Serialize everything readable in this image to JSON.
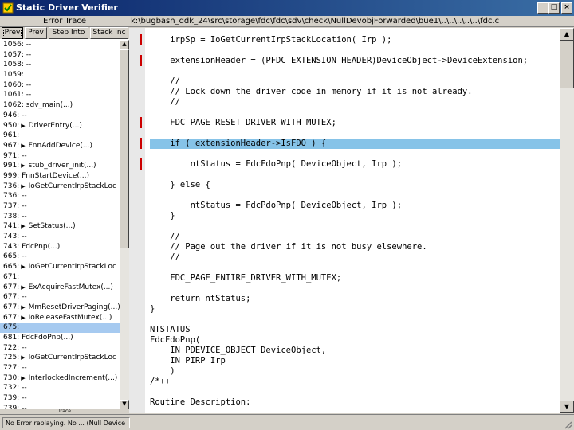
{
  "window": {
    "title": "Static Driver Verifier",
    "minimize": "_",
    "maximize": "□",
    "close": "×"
  },
  "trace_panel": {
    "header": "Error Trace",
    "buttons": [
      "Prev",
      "Prev",
      "Step Into",
      "Stack Inc"
    ],
    "footer": "Trace",
    "rows": [
      {
        "text": "1056: --",
        "arrow": false
      },
      {
        "text": "1057: --",
        "arrow": false
      },
      {
        "text": "1058: --",
        "arrow": false
      },
      {
        "text": "1059:",
        "arrow": false
      },
      {
        "text": "1060: --",
        "arrow": false
      },
      {
        "text": "1061: --",
        "arrow": false
      },
      {
        "text": "1062: sdv_main(...)",
        "arrow": false
      },
      {
        "text": "946: --",
        "arrow": false
      },
      {
        "text": "950:",
        "arrow": true,
        "call": "DriverEntry(...)"
      },
      {
        "text": "961:",
        "arrow": false
      },
      {
        "text": "967:",
        "arrow": true,
        "call": "FnnAddDevice(...)"
      },
      {
        "text": "971: --",
        "arrow": false
      },
      {
        "text": "991:",
        "arrow": true,
        "call": "stub_driver_init(...)"
      },
      {
        "text": "999: FnnStartDevice(...)",
        "arrow": false
      },
      {
        "text": "736:",
        "arrow": true,
        "call": "IoGetCurrentIrpStackLoc"
      },
      {
        "text": "736: --",
        "arrow": false
      },
      {
        "text": "737: --",
        "arrow": false
      },
      {
        "text": "738: --",
        "arrow": false
      },
      {
        "text": "741:",
        "arrow": true,
        "call": "SetStatus(...)"
      },
      {
        "text": "743: --",
        "arrow": false
      },
      {
        "text": "743: FdcPnp(...)",
        "arrow": false
      },
      {
        "text": "665: --",
        "arrow": false
      },
      {
        "text": "665:",
        "arrow": true,
        "call": "IoGetCurrentIrpStackLoc"
      },
      {
        "text": "671:",
        "arrow": false
      },
      {
        "text": "677:",
        "arrow": true,
        "call": "ExAcquireFastMutex(...)"
      },
      {
        "text": "677: --",
        "arrow": false
      },
      {
        "text": "677:",
        "arrow": true,
        "call": "MmResetDriverPaging(...)"
      },
      {
        "text": "677:",
        "arrow": true,
        "call": "IoReleaseFastMutex(...)"
      },
      {
        "text": "675:",
        "arrow": false,
        "selected": true
      },
      {
        "text": "681: FdcFdoPnp(...)",
        "arrow": false
      },
      {
        "text": "722: --",
        "arrow": false
      },
      {
        "text": "725:",
        "arrow": true,
        "call": "IoGetCurrentIrpStackLoc"
      },
      {
        "text": "727: --",
        "arrow": false
      },
      {
        "text": "730:",
        "arrow": true,
        "call": "InterlockedIncrement(...)"
      },
      {
        "text": "732: --",
        "arrow": false
      },
      {
        "text": "739: --",
        "arrow": false
      },
      {
        "text": "739: --",
        "arrow": false
      }
    ]
  },
  "code_panel": {
    "path": "k:\\bugbash_ddk_24\\src\\storage\\fdc\\fdc\\sdv\\check\\NullDevobjForwarded\\bue1\\..\\..\\..\\..\\..\\fdc.c",
    "lines": [
      {
        "text": "    irpSp = IoGetCurrentIrpStackLocation( Irp );",
        "marker": true
      },
      {
        "text": "",
        "marker": false
      },
      {
        "text": "    extensionHeader = (PFDC_EXTENSION_HEADER)DeviceObject->DeviceExtension;",
        "marker": true
      },
      {
        "text": "",
        "marker": false
      },
      {
        "text": "    //",
        "marker": false
      },
      {
        "text": "    // Lock down the driver code in memory if it is not already.",
        "marker": false
      },
      {
        "text": "    //",
        "marker": false
      },
      {
        "text": "",
        "marker": false
      },
      {
        "text": "    FDC_PAGE_RESET_DRIVER_WITH_MUTEX;",
        "marker": true
      },
      {
        "text": "",
        "marker": false
      },
      {
        "text": "    if ( extensionHeader->IsFDO ) {",
        "marker": true,
        "highlight": true
      },
      {
        "text": "",
        "marker": false
      },
      {
        "text": "        ntStatus = FdcFdoPnp( DeviceObject, Irp );",
        "marker": true
      },
      {
        "text": "",
        "marker": false
      },
      {
        "text": "    } else {",
        "marker": false
      },
      {
        "text": "",
        "marker": false
      },
      {
        "text": "        ntStatus = FdcPdoPnp( DeviceObject, Irp );",
        "marker": false
      },
      {
        "text": "    }",
        "marker": false
      },
      {
        "text": "",
        "marker": false
      },
      {
        "text": "    //",
        "marker": false
      },
      {
        "text": "    // Page out the driver if it is not busy elsewhere.",
        "marker": false
      },
      {
        "text": "    //",
        "marker": false
      },
      {
        "text": "",
        "marker": false
      },
      {
        "text": "    FDC_PAGE_ENTIRE_DRIVER_WITH_MUTEX;",
        "marker": false
      },
      {
        "text": "",
        "marker": false
      },
      {
        "text": "    return ntStatus;",
        "marker": false
      },
      {
        "text": "}",
        "marker": false
      },
      {
        "text": "",
        "marker": false
      },
      {
        "text": "NTSTATUS",
        "marker": false
      },
      {
        "text": "FdcFdoPnp(",
        "marker": false
      },
      {
        "text": "    IN PDEVICE_OBJECT DeviceObject,",
        "marker": false
      },
      {
        "text": "    IN PIRP Irp",
        "marker": false
      },
      {
        "text": "    )",
        "marker": false
      },
      {
        "text": "/*++",
        "marker": false
      },
      {
        "text": "",
        "marker": false
      },
      {
        "text": "Routine Description:",
        "marker": false
      }
    ]
  },
  "status_bar": {
    "text": "No Error replaying. No ... (Null Device"
  }
}
